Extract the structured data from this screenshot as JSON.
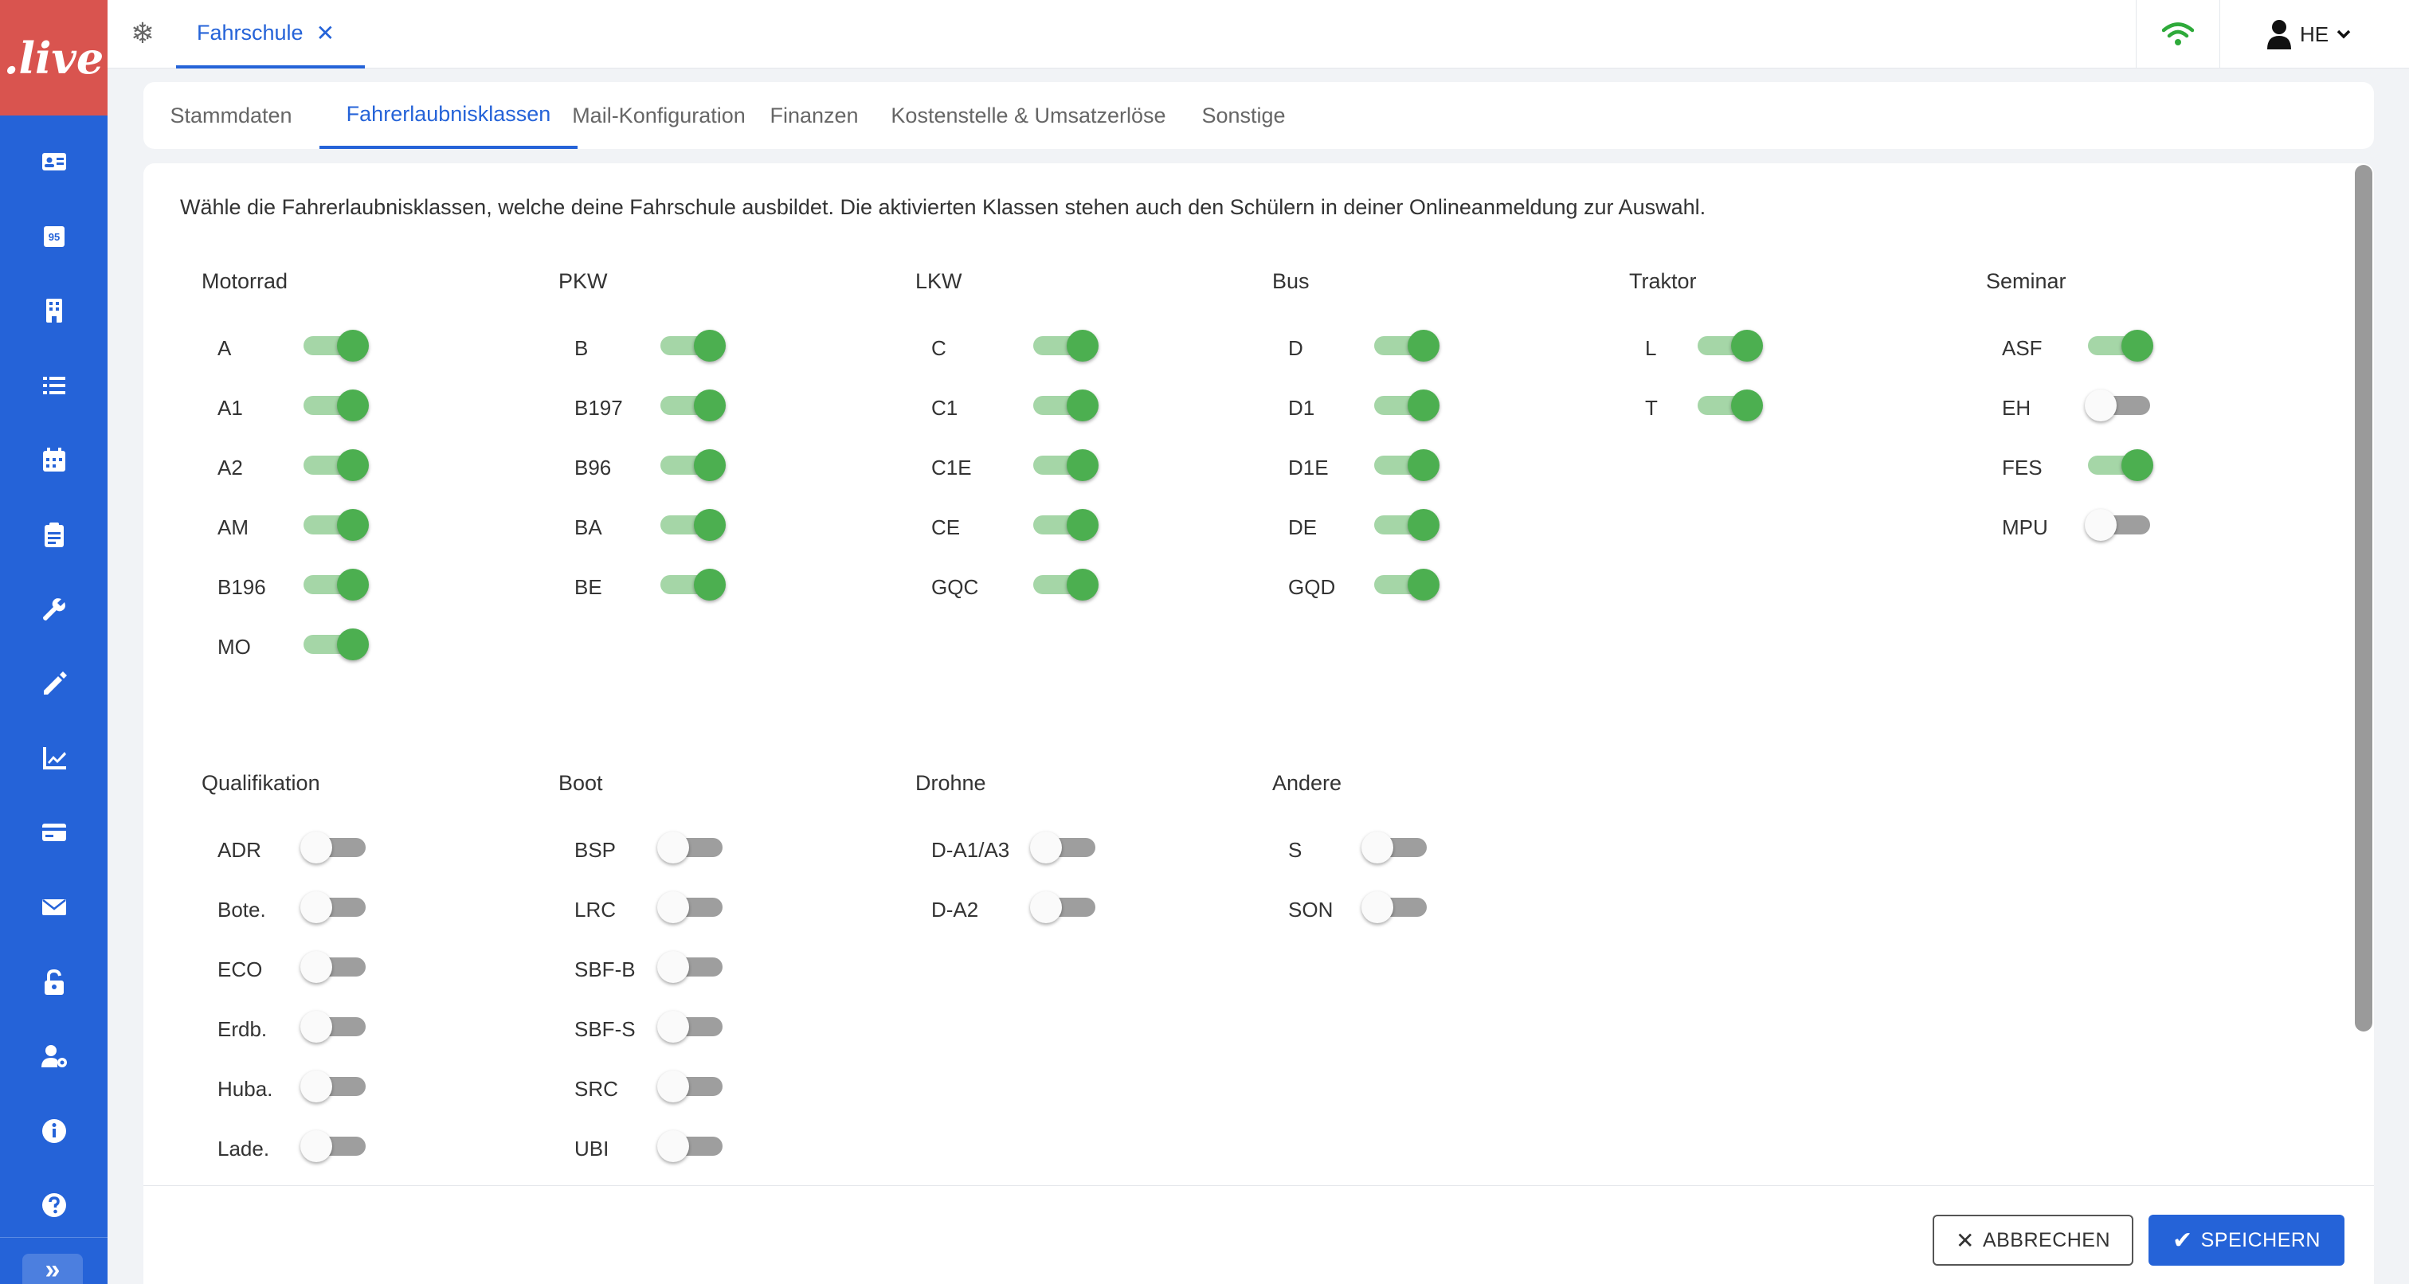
{
  "logo": {
    "text": ".live",
    "color": "#d9544f"
  },
  "accent_color": "#2563d8",
  "sidebar": {
    "items": [
      {
        "icon": "contact-card-icon"
      },
      {
        "icon": "badge-95-icon",
        "text": "95"
      },
      {
        "icon": "building-icon"
      },
      {
        "icon": "list-icon"
      },
      {
        "icon": "calendar-icon"
      },
      {
        "icon": "clipboard-icon"
      },
      {
        "icon": "wrench-icon"
      },
      {
        "icon": "pencil-icon"
      },
      {
        "icon": "chart-line-icon"
      },
      {
        "icon": "credit-card-icon"
      },
      {
        "icon": "envelope-icon"
      },
      {
        "icon": "unlock-icon"
      },
      {
        "icon": "user-gear-icon"
      },
      {
        "icon": "info-icon"
      },
      {
        "icon": "help-icon"
      }
    ],
    "expand_label": "»"
  },
  "topbar": {
    "tab_label": "Fahrschule",
    "close_glyph": "✕",
    "user_initials": "HE"
  },
  "subtabs": [
    {
      "label": "Stammdaten",
      "active": false
    },
    {
      "label": "Fahrerlaubnisklassen",
      "active": true
    },
    {
      "label": "Mail-Konfiguration",
      "active": false
    },
    {
      "label": "Finanzen",
      "active": false
    },
    {
      "label": "Kostenstelle & Umsatzerlöse",
      "active": false
    },
    {
      "label": "Sonstige",
      "active": false
    }
  ],
  "intro": "Wähle die Fahrerlaubnisklassen, welche deine Fahrschule ausbildet. Die aktivierten Klassen stehen auch den Schülern in deiner Onlineanmeldung zur Auswahl.",
  "groups": [
    {
      "title": "Motorrad",
      "classes": [
        {
          "label": "A",
          "on": true
        },
        {
          "label": "A1",
          "on": true
        },
        {
          "label": "A2",
          "on": true
        },
        {
          "label": "AM",
          "on": true
        },
        {
          "label": "B196",
          "on": true
        },
        {
          "label": "MO",
          "on": true
        }
      ]
    },
    {
      "title": "PKW",
      "classes": [
        {
          "label": "B",
          "on": true
        },
        {
          "label": "B197",
          "on": true
        },
        {
          "label": "B96",
          "on": true
        },
        {
          "label": "BA",
          "on": true
        },
        {
          "label": "BE",
          "on": true
        }
      ]
    },
    {
      "title": "LKW",
      "classes": [
        {
          "label": "C",
          "on": true
        },
        {
          "label": "C1",
          "on": true
        },
        {
          "label": "C1E",
          "on": true
        },
        {
          "label": "CE",
          "on": true
        },
        {
          "label": "GQC",
          "on": true
        }
      ]
    },
    {
      "title": "Bus",
      "classes": [
        {
          "label": "D",
          "on": true
        },
        {
          "label": "D1",
          "on": true
        },
        {
          "label": "D1E",
          "on": true
        },
        {
          "label": "DE",
          "on": true
        },
        {
          "label": "GQD",
          "on": true
        }
      ]
    },
    {
      "title": "Traktor",
      "classes": [
        {
          "label": "L",
          "on": true
        },
        {
          "label": "T",
          "on": true
        }
      ]
    },
    {
      "title": "Seminar",
      "classes": [
        {
          "label": "ASF",
          "on": true
        },
        {
          "label": "EH",
          "on": false
        },
        {
          "label": "FES",
          "on": true
        },
        {
          "label": "MPU",
          "on": false
        }
      ]
    },
    {
      "title": "Qualifikation",
      "classes": [
        {
          "label": "ADR",
          "on": false
        },
        {
          "label": "Bote.",
          "on": false
        },
        {
          "label": "ECO",
          "on": false
        },
        {
          "label": "Erdb.",
          "on": false
        },
        {
          "label": "Huba.",
          "on": false
        },
        {
          "label": "Lade.",
          "on": false
        }
      ]
    },
    {
      "title": "Boot",
      "classes": [
        {
          "label": "BSP",
          "on": false
        },
        {
          "label": "LRC",
          "on": false
        },
        {
          "label": "SBF-B",
          "on": false
        },
        {
          "label": "SBF-S",
          "on": false
        },
        {
          "label": "SRC",
          "on": false
        },
        {
          "label": "UBI",
          "on": false
        }
      ]
    },
    {
      "title": "Drohne",
      "classes": [
        {
          "label": "D-A1/A3",
          "on": false
        },
        {
          "label": "D-A2",
          "on": false
        }
      ]
    },
    {
      "title": "Andere",
      "classes": [
        {
          "label": "S",
          "on": false
        },
        {
          "label": "SON",
          "on": false
        }
      ]
    }
  ],
  "footer": {
    "cancel_label": "ABBRECHEN",
    "save_label": "SPEICHERN"
  }
}
